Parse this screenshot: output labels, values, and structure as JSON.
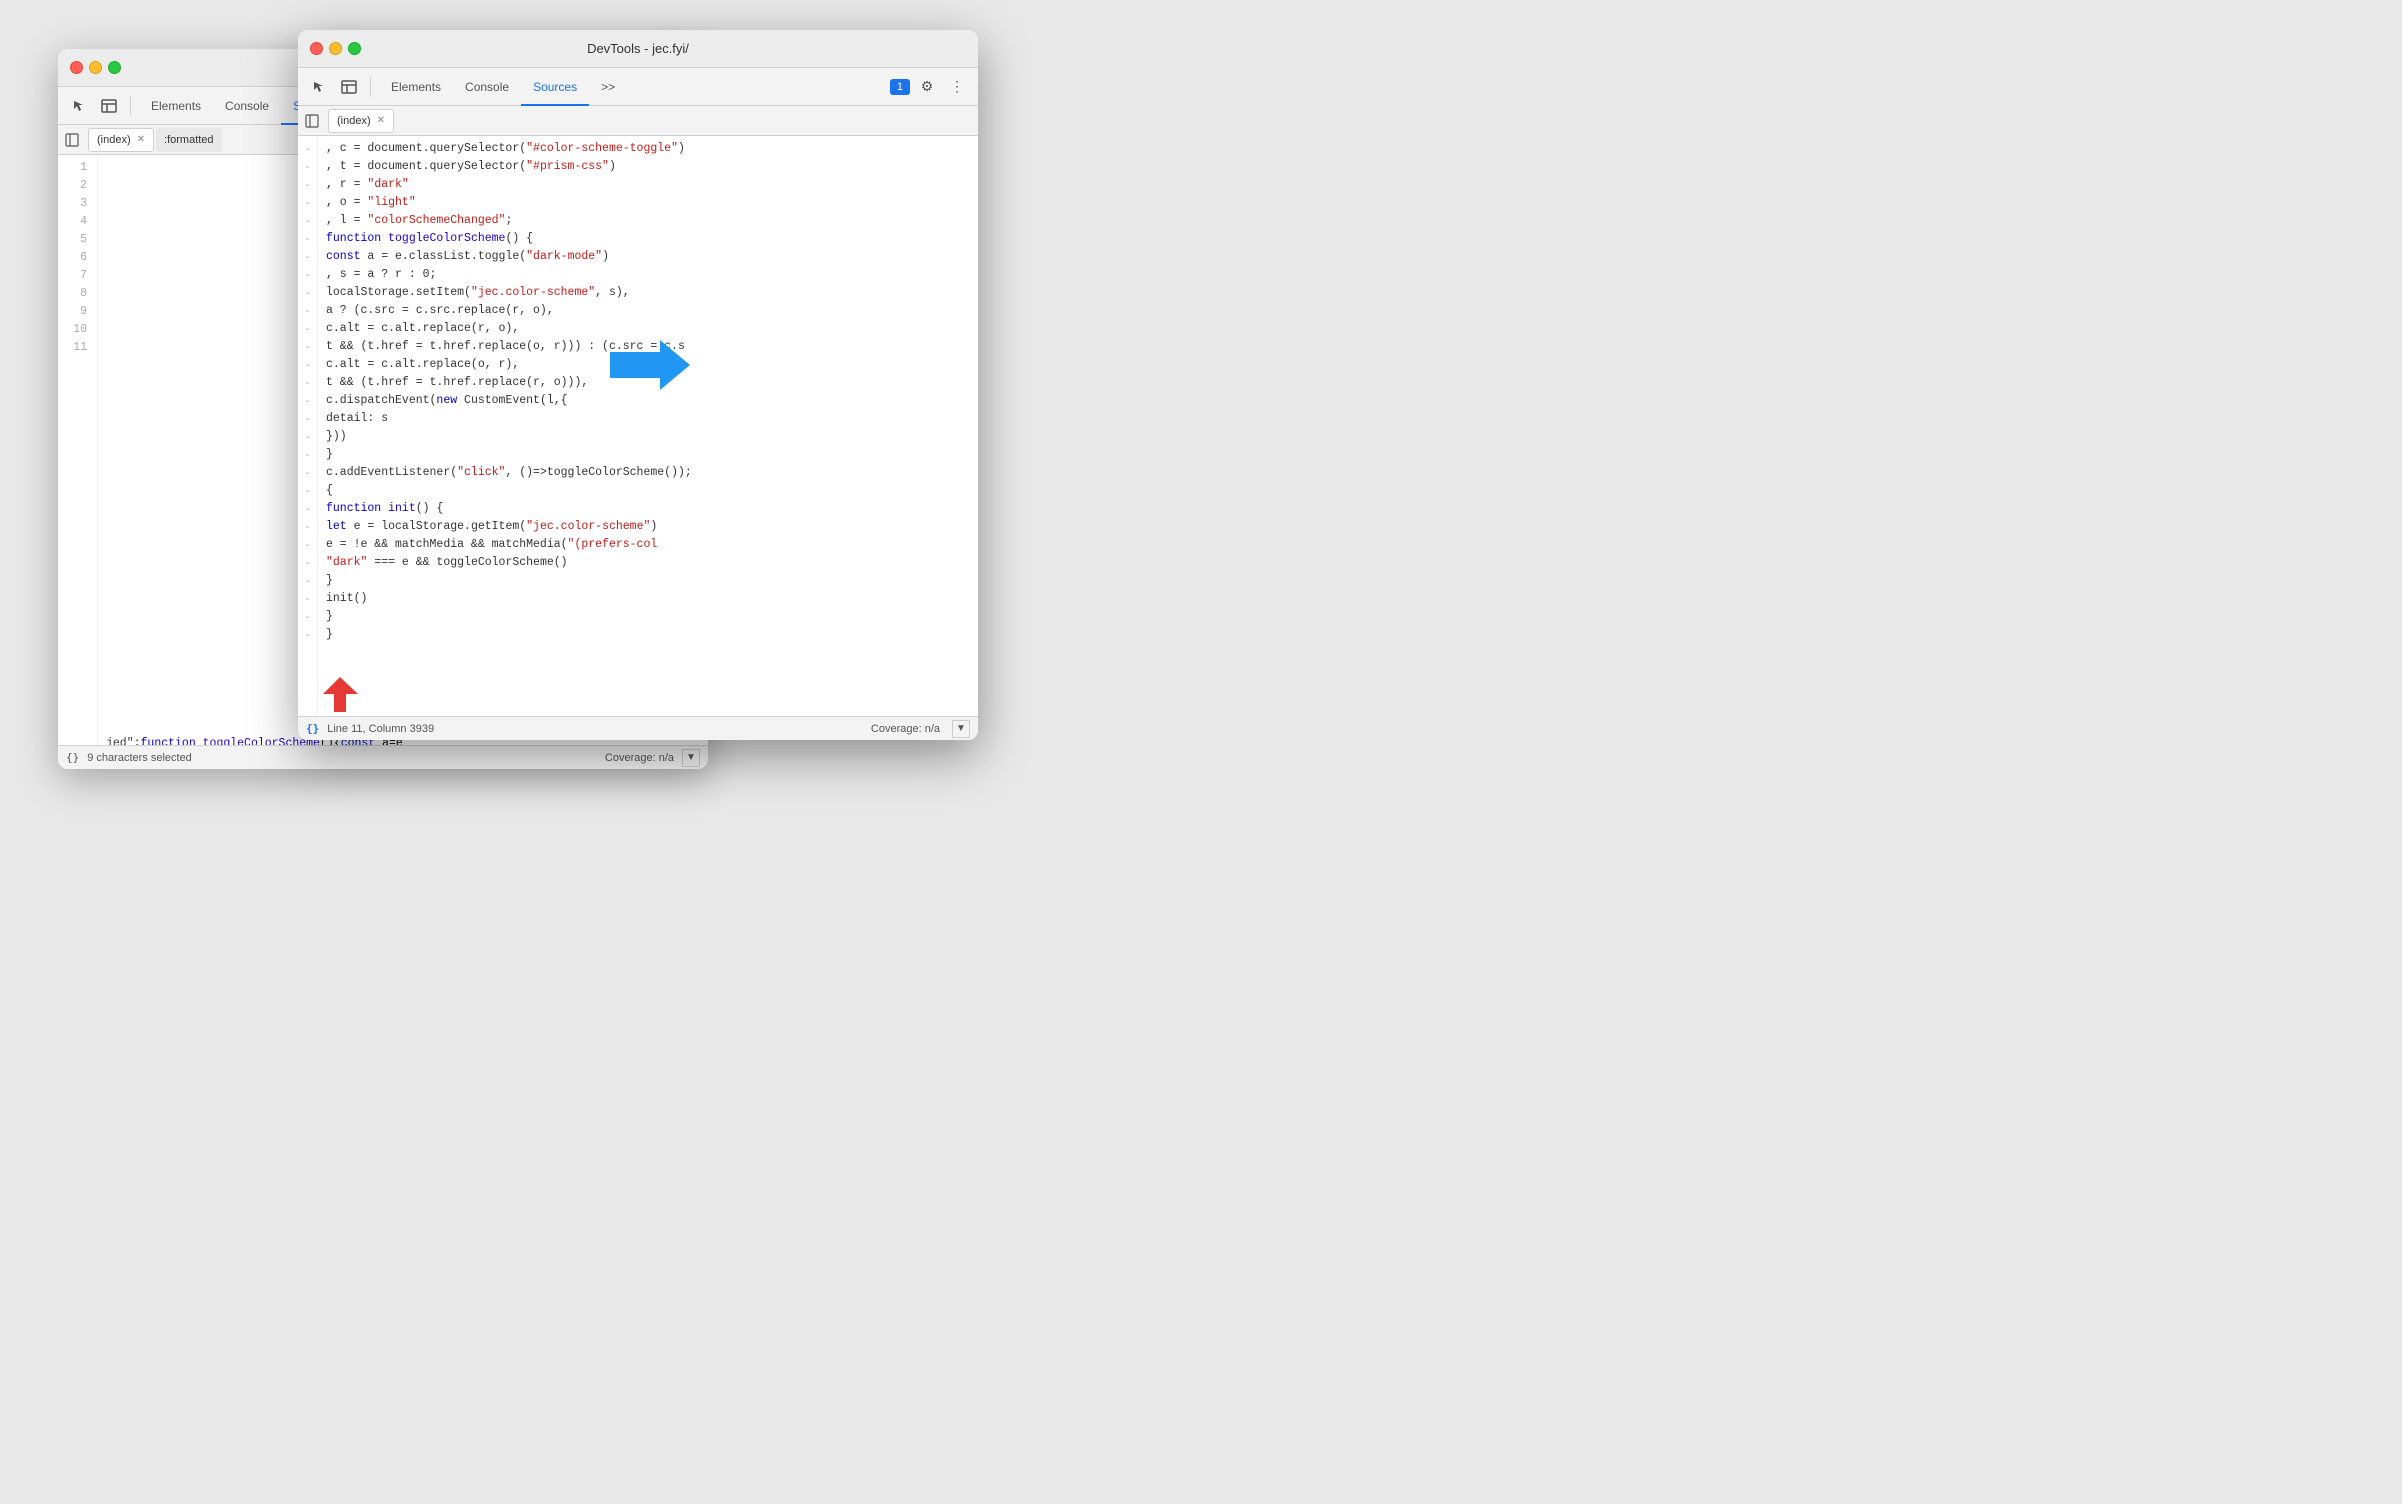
{
  "window1": {
    "title": "DevTools - jec.fyi/",
    "tabs": [
      "Elements",
      "Console",
      "Sources",
      ">>"
    ],
    "active_tab": "Sources",
    "file_tabs": [
      "(index)",
      ":formatted"
    ],
    "active_file": "(index)",
    "status": "9 characters selected",
    "coverage": "Coverage: n/a",
    "line_count": 11,
    "code_line11": "jed\";function toggleColorScheme(){const a=e"
  },
  "window2": {
    "title": "DevTools - jec.fyi/",
    "tabs": [
      "Elements",
      "Console",
      "Sources",
      ">>"
    ],
    "active_tab": "Sources",
    "file_tabs": [
      "(index)"
    ],
    "active_file": "(index)",
    "status": "Line 11, Column 3939",
    "coverage": "Coverage: n/a",
    "comment_count": "1",
    "code": [
      "        , c = document.querySelector(\"#color-scheme-toggle\")",
      "        , t = document.querySelector(\"#prism-css\")",
      "        , r = \"dark\"",
      "        , o = \"light\"",
      "        , l = \"colorSchemeChanged\";",
      "        function toggleColorScheme() {",
      "            const a = e.classList.toggle(\"dark-mode\")",
      "                , s = a ? r : 0;",
      "            localStorage.setItem(\"jec.color-scheme\", s),",
      "            a ? (c.src = c.src.replace(r, o),",
      "            c.alt = c.alt.replace(r, o),",
      "            t && (t.href = t.href.replace(o, r))) : (c.src = c.s",
      "            c.alt = c.alt.replace(o, r),",
      "            t && (t.href = t.href.replace(r, o))),",
      "            c.dispatchEvent(new CustomEvent(l,{",
      "                detail: s",
      "            }))",
      "        }",
      "        c.addEventListener(\"click\", ()=>toggleColorScheme());",
      "        {",
      "            function init() {",
      "                let e = localStorage.getItem(\"jec.color-scheme\")",
      "                e = !e && matchMedia && matchMedia(\"(prefers-col",
      "                \"dark\" === e && toggleColorScheme()",
      "            }",
      "            init()",
      "        }",
      "    }"
    ]
  },
  "icons": {
    "cursor": "↖",
    "panel": "⊞",
    "gear": "⚙",
    "dots": "⋮",
    "format": "{}",
    "chevron_right": "›"
  }
}
